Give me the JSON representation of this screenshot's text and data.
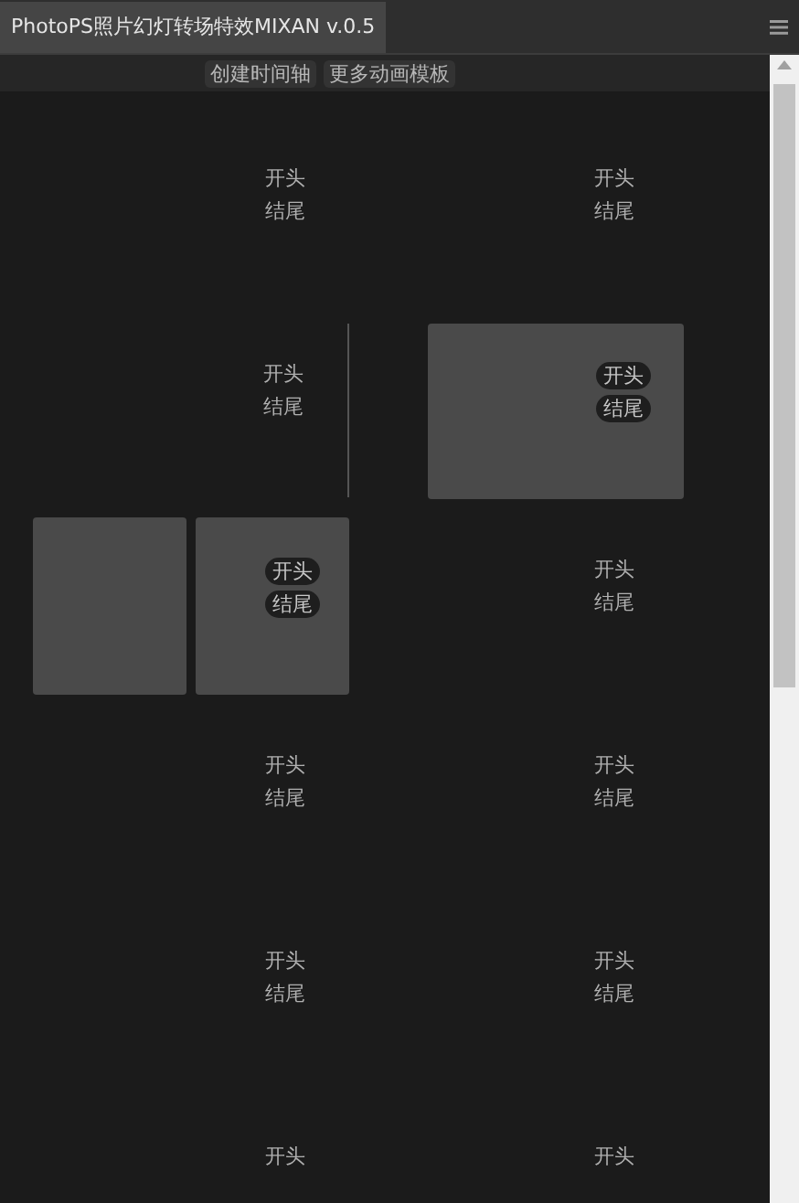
{
  "window": {
    "title": "PhotoPS照片幻灯转场特效MIXAN v.0.5"
  },
  "toolbar": [
    "创建时间轴",
    "更多动画模板"
  ],
  "rows": [
    {
      "cells": [
        {
          "kind": "plain",
          "labels": [
            "开头",
            "结尾"
          ]
        },
        {
          "kind": "plain",
          "labels": [
            "开头",
            "结尾"
          ]
        }
      ]
    },
    {
      "cells": [
        {
          "kind": "line",
          "labels": [
            "开头",
            "结尾"
          ]
        },
        {
          "kind": "box",
          "labels": [
            "开头",
            "结尾"
          ]
        }
      ]
    },
    {
      "cells": [
        {
          "kind": "split",
          "labels": [
            "开头",
            "结尾"
          ]
        },
        {
          "kind": "plain",
          "labels": [
            "开头",
            "结尾"
          ]
        }
      ]
    },
    {
      "cells": [
        {
          "kind": "plain",
          "labels": [
            "开头",
            "结尾"
          ]
        },
        {
          "kind": "plain",
          "labels": [
            "开头",
            "结尾"
          ]
        }
      ]
    },
    {
      "cells": [
        {
          "kind": "plain",
          "labels": [
            "开头",
            "结尾"
          ]
        },
        {
          "kind": "plain",
          "labels": [
            "开头",
            "结尾"
          ]
        }
      ]
    },
    {
      "cells": [
        {
          "kind": "plain",
          "labels": [
            "开头"
          ]
        },
        {
          "kind": "plain",
          "labels": [
            "开头"
          ]
        }
      ]
    }
  ]
}
